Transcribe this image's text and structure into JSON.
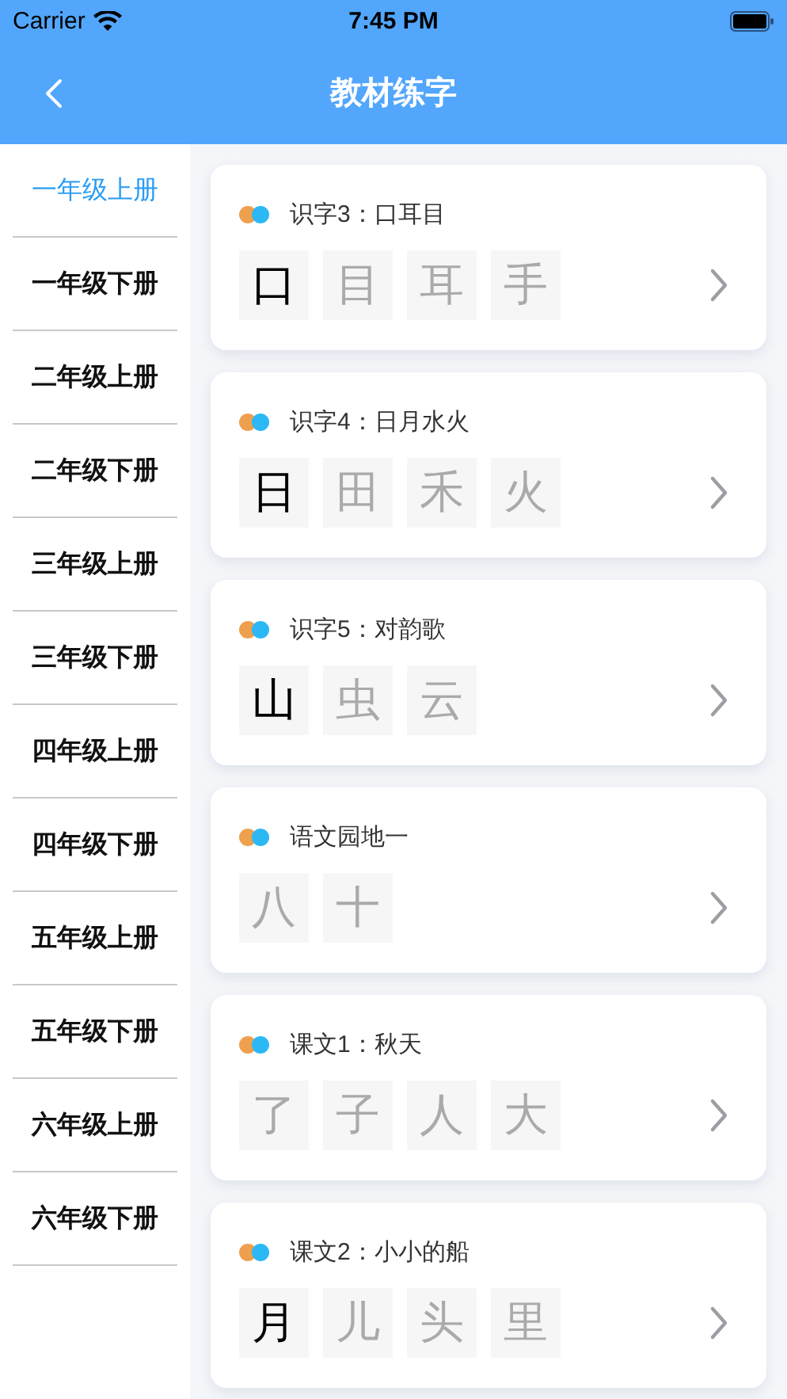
{
  "status_bar": {
    "carrier": "Carrier",
    "time": "7:45 PM"
  },
  "nav": {
    "title": "教材练字"
  },
  "sidebar": {
    "items": [
      {
        "label": "一年级上册",
        "selected": true
      },
      {
        "label": "一年级下册",
        "selected": false
      },
      {
        "label": "二年级上册",
        "selected": false
      },
      {
        "label": "二年级下册",
        "selected": false
      },
      {
        "label": "三年级上册",
        "selected": false
      },
      {
        "label": "三年级下册",
        "selected": false
      },
      {
        "label": "四年级上册",
        "selected": false
      },
      {
        "label": "四年级下册",
        "selected": false
      },
      {
        "label": "五年级上册",
        "selected": false
      },
      {
        "label": "五年级下册",
        "selected": false
      },
      {
        "label": "六年级上册",
        "selected": false
      },
      {
        "label": "六年级下册",
        "selected": false
      }
    ]
  },
  "lessons": [
    {
      "title": "识字3：口耳目",
      "characters": [
        {
          "char": "口",
          "written": true
        },
        {
          "char": "目",
          "written": false
        },
        {
          "char": "耳",
          "written": false
        },
        {
          "char": "手",
          "written": false
        }
      ]
    },
    {
      "title": "识字4：日月水火",
      "characters": [
        {
          "char": "日",
          "written": true
        },
        {
          "char": "田",
          "written": false
        },
        {
          "char": "禾",
          "written": false
        },
        {
          "char": "火",
          "written": false
        }
      ]
    },
    {
      "title": "识字5：对韵歌",
      "characters": [
        {
          "char": "山",
          "written": true
        },
        {
          "char": "虫",
          "written": false
        },
        {
          "char": "云",
          "written": false
        }
      ]
    },
    {
      "title": "语文园地一",
      "characters": [
        {
          "char": "八",
          "written": false
        },
        {
          "char": "十",
          "written": false
        }
      ]
    },
    {
      "title": "课文1：秋天",
      "characters": [
        {
          "char": "了",
          "written": false
        },
        {
          "char": "子",
          "written": false
        },
        {
          "char": "人",
          "written": false
        },
        {
          "char": "大",
          "written": false
        }
      ]
    },
    {
      "title": "课文2：小小的船",
      "characters": [
        {
          "char": "月",
          "written": true
        },
        {
          "char": "儿",
          "written": false
        },
        {
          "char": "头",
          "written": false
        },
        {
          "char": "里",
          "written": false
        }
      ]
    }
  ]
}
